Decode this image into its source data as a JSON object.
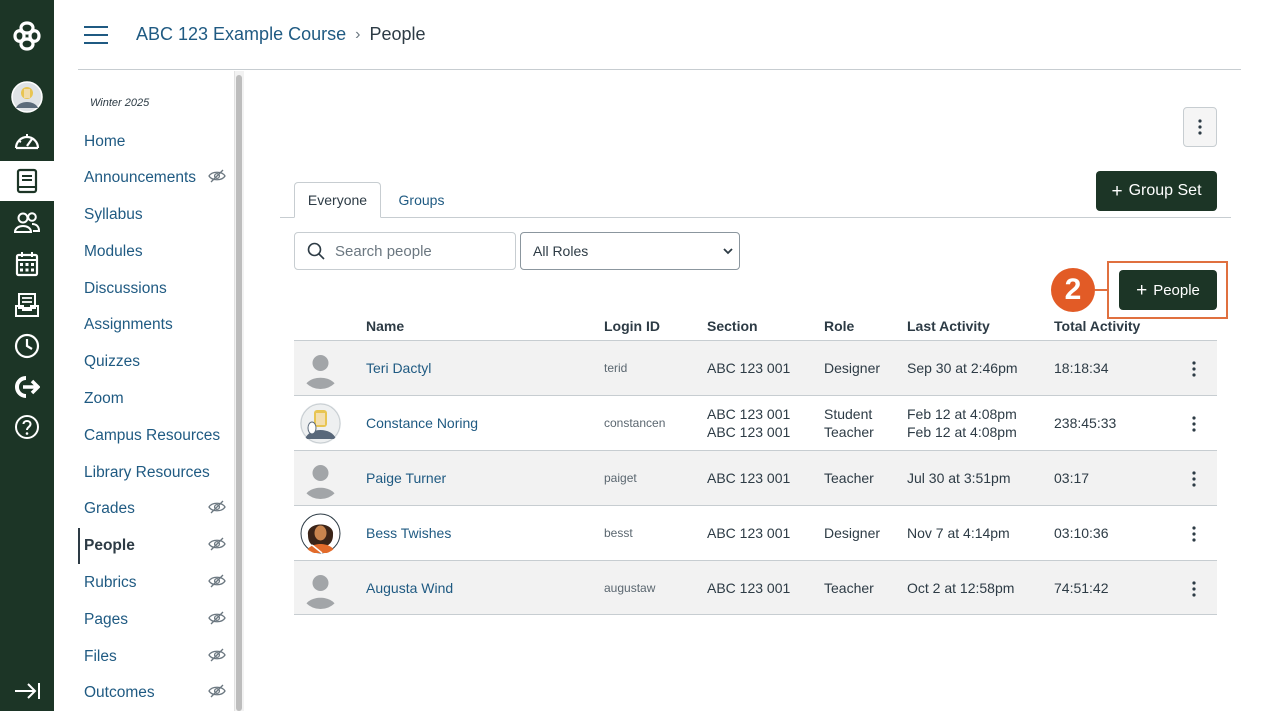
{
  "breadcrumb": {
    "course": "ABC 123 Example Course",
    "current": "People"
  },
  "course_nav": {
    "term": "Winter 2025",
    "items": [
      {
        "label": "Home",
        "hidden": false
      },
      {
        "label": "Announcements",
        "hidden": true
      },
      {
        "label": "Syllabus",
        "hidden": false
      },
      {
        "label": "Modules",
        "hidden": false
      },
      {
        "label": "Discussions",
        "hidden": false
      },
      {
        "label": "Assignments",
        "hidden": false
      },
      {
        "label": "Quizzes",
        "hidden": false
      },
      {
        "label": "Zoom",
        "hidden": false
      },
      {
        "label": "Campus Resources",
        "hidden": false
      },
      {
        "label": "Library Resources",
        "hidden": false
      },
      {
        "label": "Grades",
        "hidden": true
      },
      {
        "label": "People",
        "hidden": true,
        "active": true
      },
      {
        "label": "Rubrics",
        "hidden": true
      },
      {
        "label": "Pages",
        "hidden": true
      },
      {
        "label": "Files",
        "hidden": true
      },
      {
        "label": "Outcomes",
        "hidden": true
      }
    ]
  },
  "global_nav": [
    "logo-icon",
    "account-avatar",
    "dashboard-icon",
    "courses-icon",
    "groups-icon",
    "calendar-icon",
    "inbox-icon",
    "history-icon",
    "commons-icon",
    "help-icon",
    "collapse-nav-icon"
  ],
  "tabs": {
    "everyone": "Everyone",
    "groups": "Groups"
  },
  "buttons": {
    "group_set": "Group Set",
    "people": "People"
  },
  "search": {
    "placeholder": "Search people"
  },
  "roles_select": {
    "selected": "All Roles"
  },
  "callout": {
    "number": "2"
  },
  "table": {
    "headers": {
      "name": "Name",
      "login": "Login ID",
      "section": "Section",
      "role": "Role",
      "last_activity": "Last Activity",
      "total_activity": "Total Activity"
    },
    "rows": [
      {
        "name": "Teri Dactyl",
        "login": "terid",
        "section": "ABC 123 001",
        "section2": "",
        "role": "Designer",
        "role2": "",
        "last_activity": "Sep 30 at 2:46pm",
        "last_activity2": "",
        "total": "18:18:34"
      },
      {
        "name": "Constance Noring",
        "login": "constancen",
        "section": "ABC 123 001",
        "section2": "ABC 123 001",
        "role": "Student",
        "role2": "Teacher",
        "last_activity": "Feb 12 at 4:08pm",
        "last_activity2": "Feb 12 at 4:08pm",
        "total": "238:45:33"
      },
      {
        "name": "Paige Turner",
        "login": "paiget",
        "section": "ABC 123 001",
        "section2": "",
        "role": "Teacher",
        "role2": "",
        "last_activity": "Jul 30 at 3:51pm",
        "last_activity2": "",
        "total": "03:17"
      },
      {
        "name": "Bess Twishes",
        "login": "besst",
        "section": "ABC 123 001",
        "section2": "",
        "role": "Designer",
        "role2": "",
        "last_activity": "Nov 7 at 4:14pm",
        "last_activity2": "",
        "total": "03:10:36"
      },
      {
        "name": "Augusta Wind",
        "login": "augustaw",
        "section": "ABC 123 001",
        "section2": "",
        "role": "Teacher",
        "role2": "",
        "last_activity": "Oct 2 at 12:58pm",
        "last_activity2": "",
        "total": "74:51:42"
      }
    ]
  },
  "colors": {
    "nav_bg": "#1c3526",
    "link": "#1f5a82",
    "text": "#2d3b45",
    "button_bg": "#1c3526",
    "callout": "#e25b26"
  }
}
